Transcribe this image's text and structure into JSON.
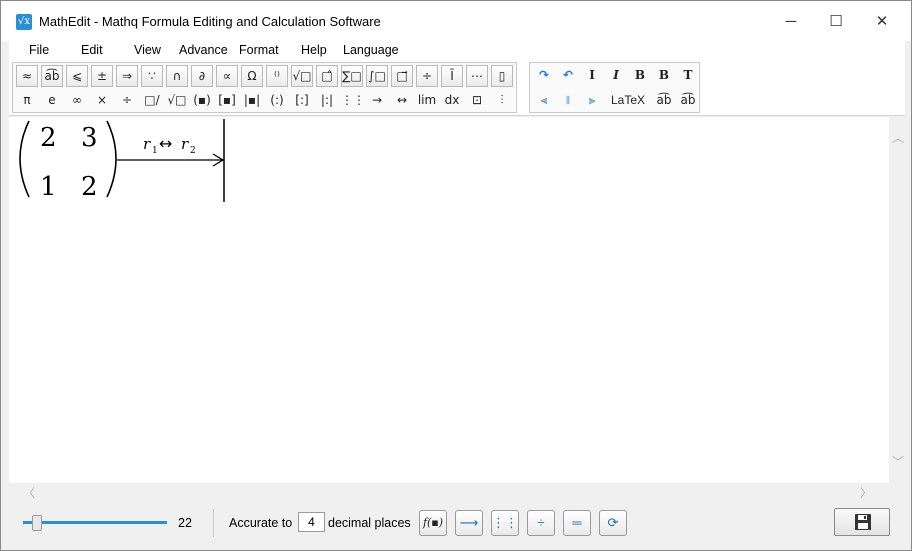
{
  "window": {
    "title": "MathEdit - Mathq Formula Editing and Calculation Software",
    "icon_glyph": "√x",
    "controls": {
      "minimize": "─",
      "maximize": "☐",
      "close": "✕"
    }
  },
  "menu": [
    "File",
    "Edit",
    "View",
    "Advance",
    "Format",
    "Help",
    "Language"
  ],
  "toolbar": {
    "row1": [
      "≈",
      "a͡b",
      "⩽",
      "±",
      "⇒",
      "∵",
      "∩",
      "∂",
      "∝",
      "Ω",
      "⁽⁾",
      "√□",
      "□̂",
      "∑□",
      "∫□",
      "□⃗",
      "÷",
      "Ī",
      "⋯",
      "▯"
    ],
    "row2": [
      "π",
      "e",
      "∞",
      "×",
      "÷",
      "□/□",
      "√□",
      "(▪)",
      "[▪]",
      "|▪|",
      "(:)",
      "[:]",
      "|:|",
      "⋮⋮",
      "→",
      "↔",
      "lim",
      "dx",
      "⊡",
      "⫶"
    ],
    "format_row1": [
      {
        "name": "redo-icon",
        "glyph": "↷"
      },
      {
        "name": "undo-icon",
        "glyph": "↶"
      },
      {
        "name": "italic-roman-icon",
        "glyph": "I"
      },
      {
        "name": "italic-icon",
        "glyph": "I"
      },
      {
        "name": "bold-icon",
        "glyph": "B"
      },
      {
        "name": "bold-light-icon",
        "glyph": "B"
      },
      {
        "name": "text-icon",
        "glyph": "T"
      }
    ],
    "format_row2": [
      {
        "name": "align-left-icon",
        "glyph": "⫷"
      },
      {
        "name": "align-center-icon",
        "glyph": "⧚"
      },
      {
        "name": "align-right-icon",
        "glyph": "⫸"
      },
      {
        "name": "latex-button",
        "glyph": "LaTeX"
      },
      {
        "name": "font-icon",
        "glyph": "a͡b"
      },
      {
        "name": "font-alt-icon",
        "glyph": "a͡b"
      }
    ]
  },
  "formula": {
    "matrix": [
      [
        "2",
        "3"
      ],
      [
        "1",
        "2"
      ]
    ],
    "operation": {
      "left": "r",
      "left_sub": "1",
      "arrow": "↔",
      "right": "r",
      "right_sub": "2"
    }
  },
  "status": {
    "font_size": "22",
    "font_size_fraction": 0.08,
    "accurate_label": "Accurate to",
    "decimal_value": "4",
    "decimal_label": "decimal places",
    "buttons": [
      {
        "name": "function-button",
        "glyph": "f(▪)"
      },
      {
        "name": "arrow-button",
        "glyph": "⟶"
      },
      {
        "name": "matrix-button",
        "glyph": "⋮⋮⋮"
      },
      {
        "name": "fraction-button",
        "glyph": "÷"
      },
      {
        "name": "equals-button",
        "glyph": "═"
      },
      {
        "name": "refresh-button",
        "glyph": "⟳"
      }
    ],
    "save_glyph": "💾"
  },
  "colors": {
    "accent": "#2a8de0",
    "icon_blue": "#1f7fd0"
  }
}
